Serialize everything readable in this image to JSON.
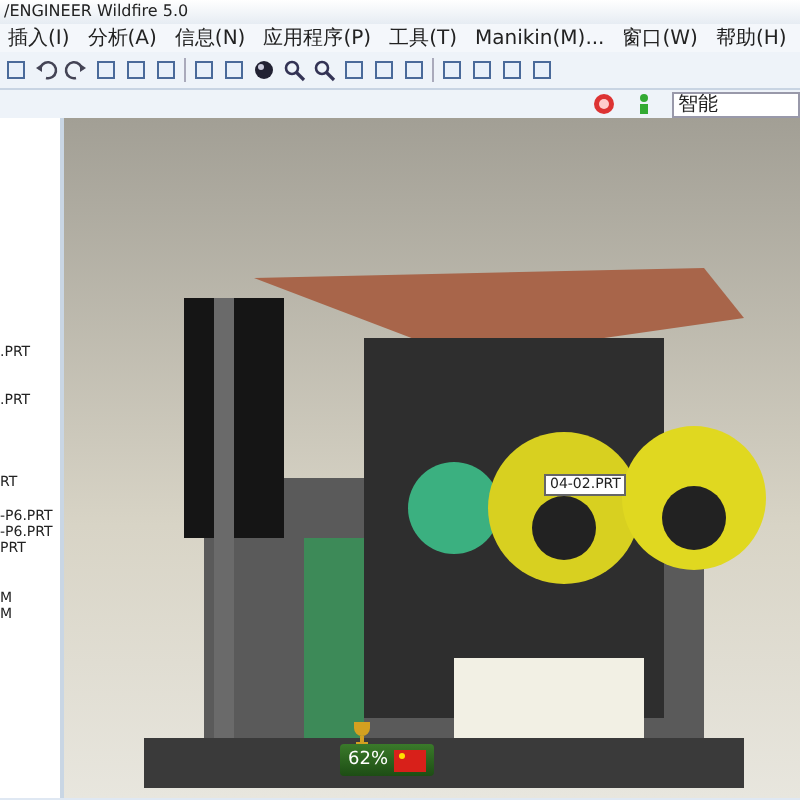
{
  "window": {
    "title": "/ENGINEER Wildfire 5.0"
  },
  "menu": [
    {
      "label": "插入(I)"
    },
    {
      "label": "分析(A)"
    },
    {
      "label": "信息(N)"
    },
    {
      "label": "应用程序(P)"
    },
    {
      "label": "工具(T)"
    },
    {
      "label": "Manikin(M)..."
    },
    {
      "label": "窗口(W)"
    },
    {
      "label": "帮助(H)"
    }
  ],
  "search": {
    "value": "智能"
  },
  "model_tree": {
    "items": [
      ".PRT",
      ".PRT",
      "RT",
      "-P6.PRT",
      "-P6.PRT",
      "PRT",
      "M",
      "M"
    ]
  },
  "viewport": {
    "tooltip": "04-02.PRT"
  },
  "network_widget": {
    "percent": "62%"
  }
}
